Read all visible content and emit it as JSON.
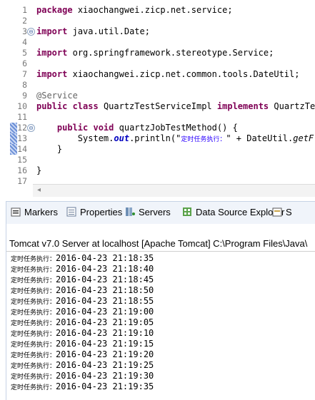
{
  "editor": {
    "lines": [
      {
        "n": "1",
        "text": "xiaochangwei.zicp.net.service;",
        "kw": "package"
      },
      {
        "n": "2"
      },
      {
        "n": "3",
        "kw": "import",
        "text": "java.util.Date;",
        "fold": "⊖"
      },
      {
        "n": "4"
      },
      {
        "n": "5",
        "kw": "import",
        "text": "org.springframework.stereotype.Service;"
      },
      {
        "n": "6"
      },
      {
        "n": "7",
        "kw": "import",
        "text": "xiaochangwei.zicp.net.common.tools.DateUtil;"
      },
      {
        "n": "8"
      },
      {
        "n": "9",
        "annotation": "@Service"
      },
      {
        "n": "10",
        "kw": "public class",
        "text": "QuartzTestServiceImpl",
        "kw2": "implements",
        "text2": "QuartzTes"
      },
      {
        "n": "11"
      },
      {
        "n": "12",
        "indent": "    ",
        "kw": "public void",
        "text": "quartzJobTestMethod() {",
        "fold": "⊖"
      },
      {
        "n": "13",
        "indent": "        ",
        "text": "System.",
        "field": "out",
        "text2": ".println(\"",
        "str": "定时任务执行：",
        "text3": "\" + DateUtil.",
        "method": "getF"
      },
      {
        "n": "14",
        "indent": "    ",
        "text": "}"
      },
      {
        "n": "15"
      },
      {
        "n": "16",
        "text": "}"
      },
      {
        "n": "17"
      }
    ]
  },
  "scroll_left_glyph": "◂",
  "tabs": [
    {
      "label": "Markers",
      "icon": "markers-icon"
    },
    {
      "label": "Properties",
      "icon": "properties-icon"
    },
    {
      "label": "Servers",
      "icon": "servers-icon"
    },
    {
      "label": "Data Source Explorer",
      "icon": "data-source-icon"
    },
    {
      "label": "S",
      "icon": "snippets-icon"
    }
  ],
  "console": {
    "title": "Tomcat v7.0 Server at localhost [Apache Tomcat] C:\\Program Files\\Java\\",
    "prefix": "定时任务执行：",
    "lines": [
      "2016-04-23 21:18:35",
      "2016-04-23 21:18:40",
      "2016-04-23 21:18:45",
      "2016-04-23 21:18:50",
      "2016-04-23 21:18:55",
      "2016-04-23 21:19:00",
      "2016-04-23 21:19:05",
      "2016-04-23 21:19:10",
      "2016-04-23 21:19:15",
      "2016-04-23 21:19:20",
      "2016-04-23 21:19:25",
      "2016-04-23 21:19:30",
      "2016-04-23 21:19:35"
    ]
  },
  "colors": {
    "keyword": "#7f0055",
    "string": "#2a00ff",
    "field": "#0000c0",
    "annotation": "#646464",
    "tab_bar": "#f0f4fa"
  }
}
